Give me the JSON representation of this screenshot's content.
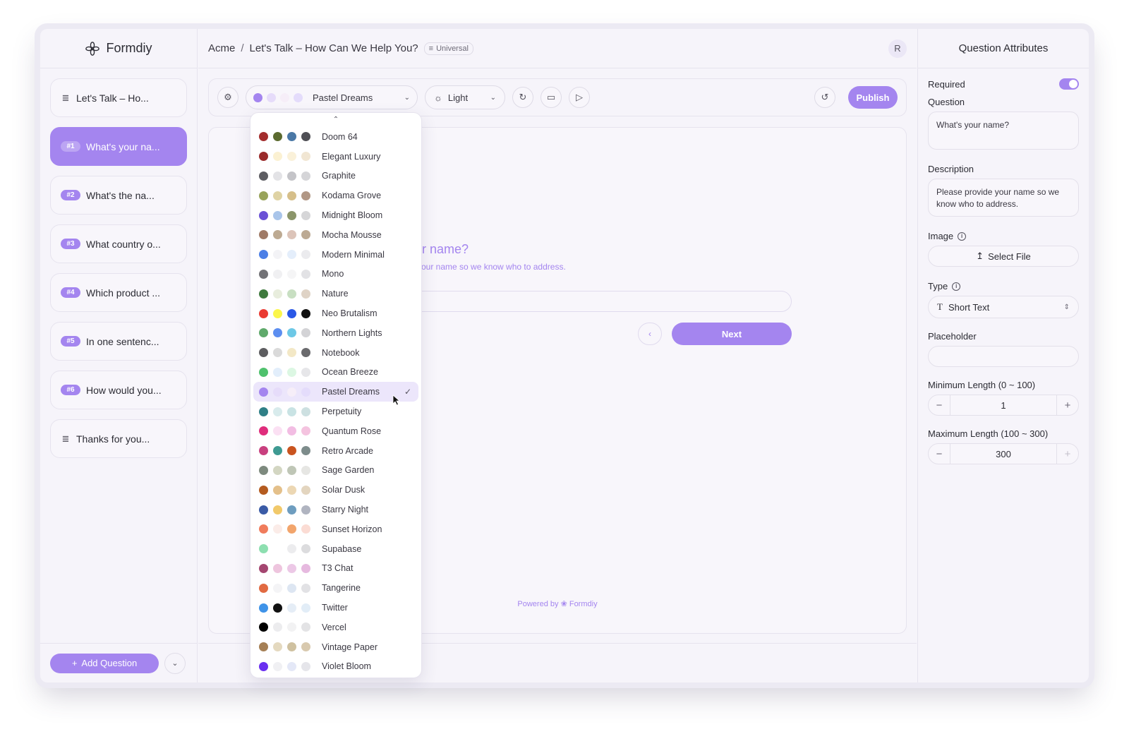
{
  "app": {
    "name": "Formdiy"
  },
  "breadcrumb": {
    "org": "Acme",
    "separator": "/",
    "form": "Let's Talk – How Can We Help You?",
    "scope": "Universal"
  },
  "user": {
    "initial": "R"
  },
  "sidebar": {
    "items": [
      {
        "badge": "",
        "label": "Let's Talk – Ho...",
        "type": "welcome"
      },
      {
        "badge": "#1",
        "label": "What's your na...",
        "active": true
      },
      {
        "badge": "#2",
        "label": "What's the na..."
      },
      {
        "badge": "#3",
        "label": "What country o..."
      },
      {
        "badge": "#4",
        "label": "Which product ..."
      },
      {
        "badge": "#5",
        "label": "In one sentenc..."
      },
      {
        "badge": "#6",
        "label": "How would you..."
      },
      {
        "badge": "",
        "label": "Thanks for you...",
        "type": "ending"
      }
    ],
    "add_question_label": "Add Question"
  },
  "toolbar": {
    "theme": {
      "selected": "Pastel Dreams",
      "colors": [
        "#a485ef",
        "#e6dcfa",
        "#f6eef8",
        "#e4dcfb"
      ]
    },
    "mode": "Light",
    "publish_label": "Publish"
  },
  "preview": {
    "question_partial": "ur name?",
    "description_partial": "your name so we know who to address.",
    "next_label": "Next",
    "powered_by": "Powered by",
    "powered_brand": "Formdiy"
  },
  "theme_dropdown": {
    "selected": "Pastel Dreams",
    "themes": [
      {
        "name": "Doom 64",
        "colors": [
          "#a32d2d",
          "#5b6a2f",
          "#4a78a6",
          "#4f4f55"
        ]
      },
      {
        "name": "Elegant Luxury",
        "colors": [
          "#9a2b2b",
          "#fbf1d2",
          "#faf1d9",
          "#f1e6d3"
        ]
      },
      {
        "name": "Graphite",
        "colors": [
          "#5d5d62",
          "#e3e3e6",
          "#c4c4c8",
          "#d5d5d8"
        ]
      },
      {
        "name": "Kodama Grove",
        "colors": [
          "#98a35a",
          "#dfd3a4",
          "#d6bf8a",
          "#b19785"
        ]
      },
      {
        "name": "Midnight Bloom",
        "colors": [
          "#6a51d6",
          "#a9c5ea",
          "#8b956a",
          "#d6d6d8"
        ]
      },
      {
        "name": "Mocha Mousse",
        "colors": [
          "#9f7a66",
          "#bdaa92",
          "#dcc4b9",
          "#bcaa94"
        ]
      },
      {
        "name": "Modern Minimal",
        "colors": [
          "#4b7fe6",
          "#f3f3f6",
          "#e4eefb",
          "#ebebee"
        ]
      },
      {
        "name": "Mono",
        "colors": [
          "#727276",
          "#f0f0f2",
          "#f5f5f6",
          "#e2e2e5"
        ]
      },
      {
        "name": "Nature",
        "colors": [
          "#3f7a3e",
          "#e8eddd",
          "#c8dfc2",
          "#dfd3c6"
        ]
      },
      {
        "name": "Neo Brutalism",
        "colors": [
          "#ea3b32",
          "#fbf64b",
          "#2a58e6",
          "#111111"
        ]
      },
      {
        "name": "Northern Lights",
        "colors": [
          "#5fa96b",
          "#5c8ef0",
          "#6dc8e6",
          "#d3d3d6"
        ]
      },
      {
        "name": "Notebook",
        "colors": [
          "#5d5d60",
          "#dadada",
          "#f3e8c6",
          "#6a6a6d"
        ]
      },
      {
        "name": "Ocean Breeze",
        "colors": [
          "#4fc16d",
          "#e2eefb",
          "#dcf7e3",
          "#e6e6e9"
        ]
      },
      {
        "name": "Pastel Dreams",
        "colors": [
          "#a485ef",
          "#e6dcfa",
          "#f6eef8",
          "#e4dcfb"
        ]
      },
      {
        "name": "Perpetuity",
        "colors": [
          "#2f7f86",
          "#d8ebec",
          "#c9e3e4",
          "#cde0e1"
        ]
      },
      {
        "name": "Quantum Rose",
        "colors": [
          "#df2d7c",
          "#fbe0f3",
          "#f2bde3",
          "#f4c3df"
        ]
      },
      {
        "name": "Retro Arcade",
        "colors": [
          "#c8407f",
          "#3e9a92",
          "#c9541f",
          "#7d8c8b"
        ]
      },
      {
        "name": "Sage Garden",
        "colors": [
          "#7d8a7e",
          "#d3d6c2",
          "#bfc6b6",
          "#e6e6e3"
        ]
      },
      {
        "name": "Solar Dusk",
        "colors": [
          "#b45b1f",
          "#e4c08a",
          "#ecd7b3",
          "#e3d5bf"
        ]
      },
      {
        "name": "Starry Night",
        "colors": [
          "#3a5ba6",
          "#f1c96a",
          "#6e9dbf",
          "#b0b4c0"
        ]
      },
      {
        "name": "Sunset Horizon",
        "colors": [
          "#f07c5c",
          "#fbece8",
          "#f2a56c",
          "#fbdcd4"
        ]
      },
      {
        "name": "Supabase",
        "colors": [
          "#8ddfb0",
          "#ffffff",
          "#ececee",
          "#dcdcde"
        ]
      },
      {
        "name": "T3 Chat",
        "colors": [
          "#a44670",
          "#eec5de",
          "#ecc8e6",
          "#e6b9df"
        ]
      },
      {
        "name": "Tangerine",
        "colors": [
          "#e16a42",
          "#f4f4f6",
          "#dde6f2",
          "#e2e2e5"
        ]
      },
      {
        "name": "Twitter",
        "colors": [
          "#3f93e8",
          "#111111",
          "#e5edf6",
          "#e2edf7"
        ]
      },
      {
        "name": "Vercel",
        "colors": [
          "#000000",
          "#ececee",
          "#f2f2f3",
          "#e3e3e5"
        ]
      },
      {
        "name": "Vintage Paper",
        "colors": [
          "#a57f55",
          "#e4d9bf",
          "#cfc1a0",
          "#d8c9ae"
        ]
      },
      {
        "name": "Violet Bloom",
        "colors": [
          "#6a2ff0",
          "#f0f0f3",
          "#e4e8f7",
          "#e5e5ea"
        ]
      }
    ]
  },
  "attributes": {
    "title": "Question Attributes",
    "required_label": "Required",
    "required": true,
    "question_label": "Question",
    "question_value": "What's your name?",
    "description_label": "Description",
    "description_value": "Please provide your name so we know who to address.",
    "image_label": "Image",
    "select_file_label": "Select File",
    "type_label": "Type",
    "type_value": "Short Text",
    "placeholder_label": "Placeholder",
    "placeholder_value": "",
    "min_length_label": "Minimum Length (0 ~ 100)",
    "min_length_value": "1",
    "max_length_label": "Maximum Length (100 ~ 300)",
    "max_length_value": "300"
  }
}
